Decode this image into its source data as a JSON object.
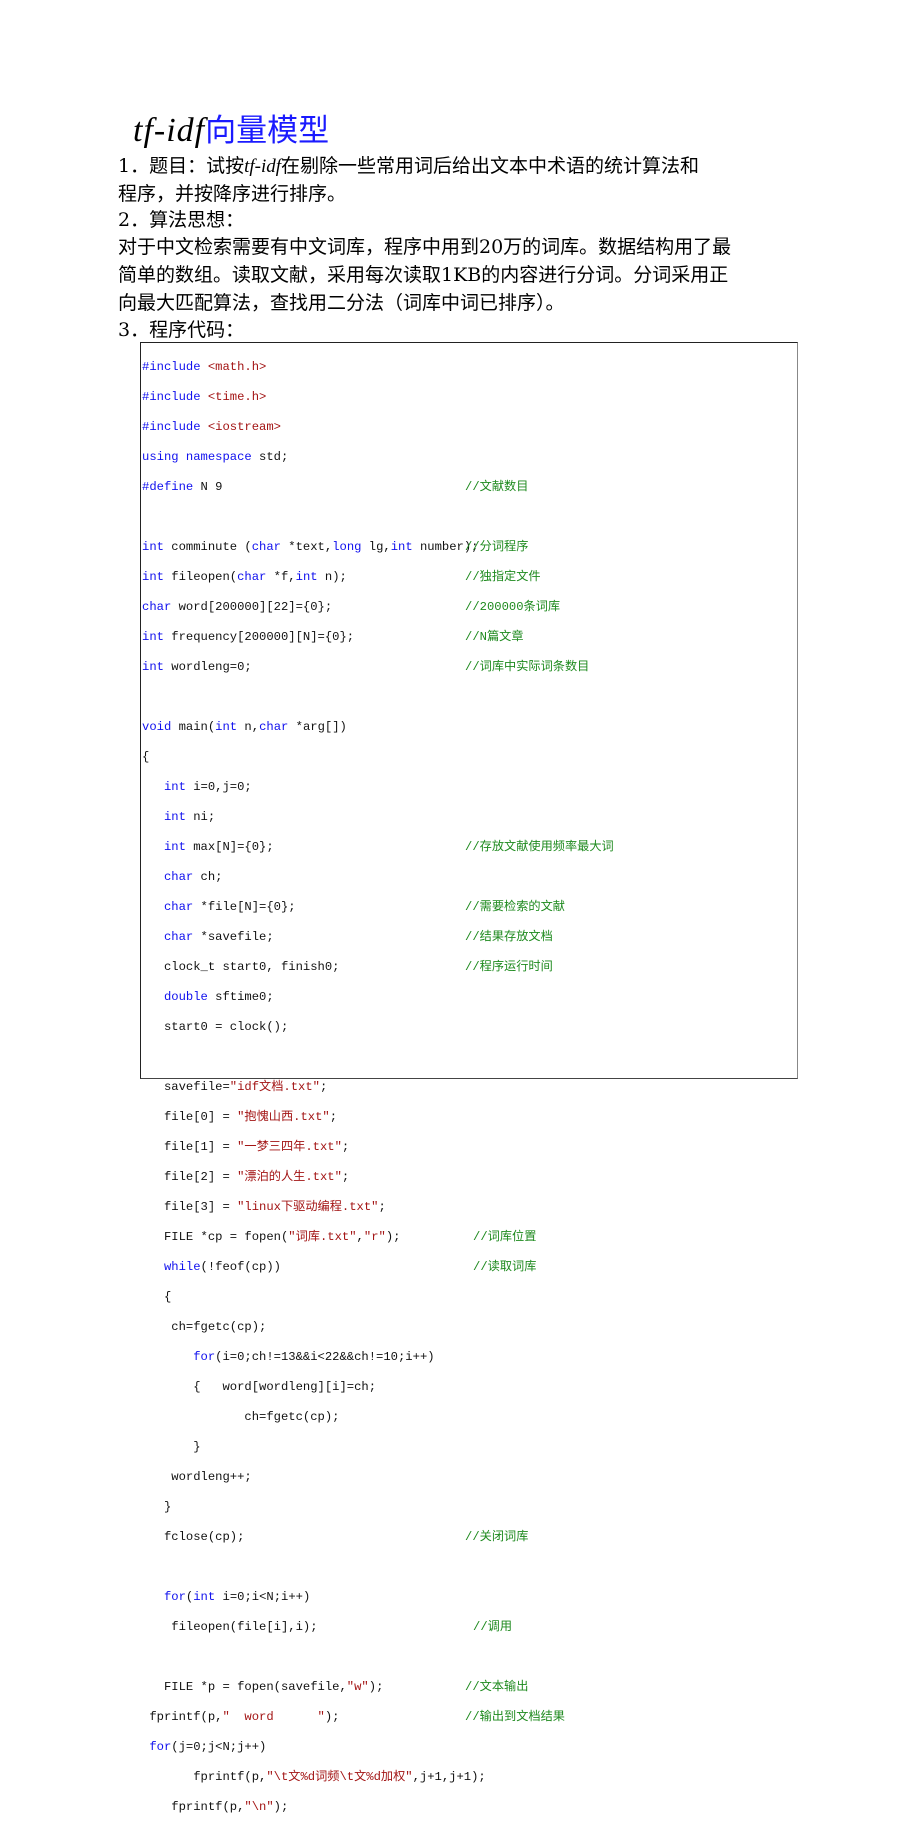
{
  "title": {
    "latin": "tf-idf",
    "cjk": "向量模型"
  },
  "sections": {
    "s1_line1_pre": "1．题目：试按",
    "s1_line1_it": "tf-idf",
    "s1_line1_post": "在剔除一些常用词后给出文本中术语的统计算法和",
    "s1_line2": "程序，并按降序进行排序。",
    "s2_heading": "2．算法思想：",
    "s2_line1": " 对于中文检索需要有中文词库，程序中用到20万的词库。数据结构用了最",
    "s2_line2": "简单的数组。读取文献，采用每次读取1KB的内容进行分词。分词采用正",
    "s2_line3": "向最大匹配算法，查找用二分法（词库中词已排序）。",
    "s3_heading": "3．程序代码："
  },
  "code": {
    "l01": [
      "#include ",
      "<math.h>"
    ],
    "l02": [
      "#include ",
      "<time.h>"
    ],
    "l03": [
      "#include ",
      "<iostream>"
    ],
    "l04": [
      "using namespace",
      " std;"
    ],
    "l05": [
      "#define",
      " N 9",
      "//文献数目"
    ],
    "l07": [
      "int",
      " comminute (",
      "char",
      " *text,",
      "long",
      " lg,",
      "int",
      " number);",
      "//分词程序"
    ],
    "l08": [
      "int",
      " fileopen(",
      "char",
      " *f,",
      "int",
      " n);",
      "//独指定文件"
    ],
    "l09": [
      "char",
      " word[200000][22]={0};",
      "//200000条词库"
    ],
    "l10": [
      "int",
      " frequency[200000][N]={0};",
      "//N篇文章"
    ],
    "l11": [
      "int",
      " wordleng=0;",
      "//词库中实际词条数目"
    ],
    "l13": [
      "void",
      " main(",
      "int",
      " n,",
      "char",
      " *arg[])"
    ],
    "l14": [
      "{"
    ],
    "l15": [
      "   ",
      "int",
      " i=0,j=0;"
    ],
    "l16": [
      "   ",
      "int",
      " ni;"
    ],
    "l17": [
      "   ",
      "int",
      " max[N]={0};",
      "//存放文献使用频率最大词"
    ],
    "l18": [
      "   ",
      "char",
      " ch;"
    ],
    "l19": [
      "   ",
      "char",
      " *file[N]={0};",
      "//需要检索的文献"
    ],
    "l20": [
      "   ",
      "char",
      " *savefile;",
      "//结果存放文档"
    ],
    "l21": [
      "   clock_t start0, finish0;",
      "//程序运行时间"
    ],
    "l22": [
      "   ",
      "double",
      " sftime0;"
    ],
    "l23": [
      "   start0 = clock();"
    ],
    "l25": [
      "   savefile=",
      "\"idf文档.txt\"",
      ";"
    ],
    "l26": [
      "   file[0] = ",
      "\"抱愧山西.txt\"",
      ";"
    ],
    "l27": [
      "   file[1] = ",
      "\"一梦三四年.txt\"",
      ";"
    ],
    "l28": [
      "   file[2] = ",
      "\"漂泊的人生.txt\"",
      ";"
    ],
    "l29": [
      "   file[3] = ",
      "\"linux下驱动编程.txt\"",
      ";"
    ],
    "l30": [
      "   FILE *cp = fopen(",
      "\"词库.txt\"",
      ",",
      "\"r\"",
      ");",
      "//词库位置"
    ],
    "l31": [
      "   ",
      "while",
      "(!feof(cp))",
      "//读取词库"
    ],
    "l32": [
      "   {"
    ],
    "l33": [
      "    ch=fgetc(cp);"
    ],
    "l34": [
      "       ",
      "for",
      "(i=0;ch!=13&&i<22&&ch!=10;i++)"
    ],
    "l35": [
      "       {   word[wordleng][i]=ch;"
    ],
    "l36": [
      "              ch=fgetc(cp);"
    ],
    "l37": [
      "       }"
    ],
    "l38": [
      "    wordleng++;"
    ],
    "l39": [
      "   }"
    ],
    "l40": [
      "   fclose(cp);",
      "//关闭词库"
    ],
    "l42": [
      "   ",
      "for",
      "(",
      "int",
      " i=0;i<N;i++)"
    ],
    "l43": [
      "    fileopen(file[i],i);",
      "//调用"
    ],
    "l45": [
      "   FILE *p = fopen(savefile,",
      "\"w\"",
      ");",
      "//文本输出"
    ],
    "l46": [
      " fprintf(p,",
      "\"  word      \"",
      ");",
      "//输出到文档结果"
    ],
    "l47": [
      " ",
      "for",
      "(j=0;j<N;j++)"
    ],
    "l48": [
      "       fprintf(p,",
      "\"\\t文%d词频\\t文%d加权\"",
      ",j+1,j+1);"
    ],
    "l49": [
      "    fprintf(p,",
      "\"\\n\"",
      ");"
    ]
  }
}
